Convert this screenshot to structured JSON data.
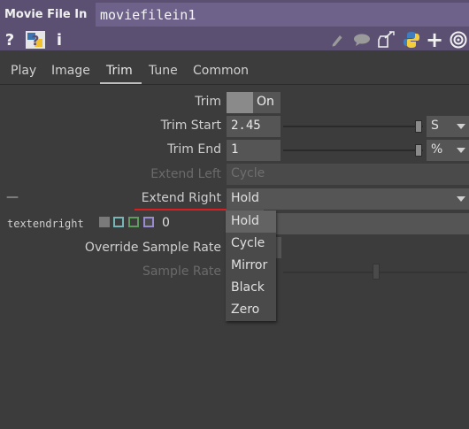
{
  "header": {
    "op_type": "Movie File In",
    "op_name": "moviefilein1"
  },
  "toolbar": {
    "icons": [
      "help-icon",
      "python-help-icon",
      "info-icon",
      "edit-icon",
      "comment-icon",
      "clone-icon",
      "python-icon",
      "add-icon",
      "target-icon"
    ],
    "help_glyph": "?",
    "info_glyph": "i",
    "add_glyph": "+"
  },
  "tabs": [
    {
      "label": "Play"
    },
    {
      "label": "Image"
    },
    {
      "label": "Trim",
      "active": true
    },
    {
      "label": "Tune"
    },
    {
      "label": "Common"
    }
  ],
  "params": {
    "trim": {
      "label": "Trim",
      "value": "On"
    },
    "trim_start": {
      "label": "Trim Start",
      "value": "2.45",
      "unit": "S"
    },
    "trim_end": {
      "label": "Trim End",
      "value": "1",
      "unit": "%"
    },
    "extend_left": {
      "label": "Extend Left",
      "value": "Cycle",
      "disabled": true
    },
    "extend_right": {
      "label": "Extend Right",
      "value": "Hold",
      "dash": "—"
    },
    "expr": {
      "name": "textendright",
      "value": "0"
    },
    "override_sample_rate": {
      "label": "Override Sample Rate"
    },
    "sample_rate": {
      "label": "Sample Rate",
      "disabled": true
    }
  },
  "dropdown": {
    "options": [
      "Hold",
      "Cycle",
      "Mirror",
      "Black",
      "Zero"
    ],
    "selected": "Hold"
  },
  "colors": {
    "header": "#5b5072",
    "name_field": "#6e628a",
    "panel": "#3c3c3c",
    "underline_red": "#d81e1e",
    "mode_cyan": "#76b6b6",
    "mode_green": "#5f9a5f",
    "mode_purple": "#9a8ad0"
  }
}
